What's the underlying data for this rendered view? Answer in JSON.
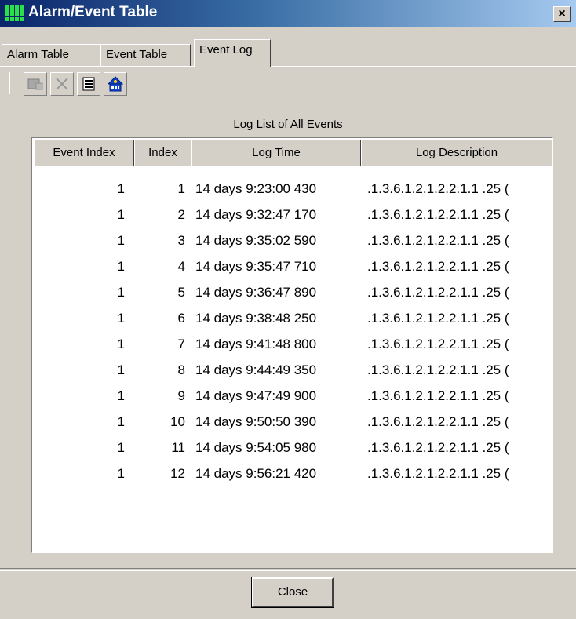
{
  "window": {
    "title": "Alarm/Event Table",
    "close_glyph": "×",
    "icon": "grid-app-icon"
  },
  "tabs": [
    {
      "label": "Alarm Table",
      "active": false
    },
    {
      "label": "Event Table",
      "active": false
    },
    {
      "label": "Event Log",
      "active": true
    }
  ],
  "toolbar": {
    "buttons": [
      {
        "icon": "edit-entry-icon",
        "enabled": false
      },
      {
        "icon": "delete-x-icon",
        "enabled": false
      },
      {
        "icon": "details-list-icon",
        "enabled": true
      },
      {
        "icon": "house-network-icon",
        "enabled": true
      }
    ]
  },
  "log_list": {
    "title": "Log List of All Events",
    "columns": [
      "Event Index",
      "Index",
      "Log Time",
      "Log Description"
    ],
    "rows": [
      {
        "event_index": "1",
        "index": "1",
        "log_time": "14 days 9:23:00 430",
        "log_description": ".1.3.6.1.2.1.2.2.1.1 .25 ("
      },
      {
        "event_index": "1",
        "index": "2",
        "log_time": "14 days 9:32:47 170",
        "log_description": ".1.3.6.1.2.1.2.2.1.1 .25 ("
      },
      {
        "event_index": "1",
        "index": "3",
        "log_time": "14 days 9:35:02 590",
        "log_description": ".1.3.6.1.2.1.2.2.1.1 .25 ("
      },
      {
        "event_index": "1",
        "index": "4",
        "log_time": "14 days 9:35:47 710",
        "log_description": ".1.3.6.1.2.1.2.2.1.1 .25 ("
      },
      {
        "event_index": "1",
        "index": "5",
        "log_time": "14 days 9:36:47 890",
        "log_description": ".1.3.6.1.2.1.2.2.1.1 .25 ("
      },
      {
        "event_index": "1",
        "index": "6",
        "log_time": "14 days 9:38:48 250",
        "log_description": ".1.3.6.1.2.1.2.2.1.1 .25 ("
      },
      {
        "event_index": "1",
        "index": "7",
        "log_time": "14 days 9:41:48 800",
        "log_description": ".1.3.6.1.2.1.2.2.1.1 .25 ("
      },
      {
        "event_index": "1",
        "index": "8",
        "log_time": "14 days 9:44:49 350",
        "log_description": ".1.3.6.1.2.1.2.2.1.1 .25 ("
      },
      {
        "event_index": "1",
        "index": "9",
        "log_time": "14 days 9:47:49 900",
        "log_description": ".1.3.6.1.2.1.2.2.1.1 .25 ("
      },
      {
        "event_index": "1",
        "index": "10",
        "log_time": "14 days 9:50:50 390",
        "log_description": ".1.3.6.1.2.1.2.2.1.1 .25 ("
      },
      {
        "event_index": "1",
        "index": "11",
        "log_time": "14 days 9:54:05 980",
        "log_description": ".1.3.6.1.2.1.2.2.1.1 .25 ("
      },
      {
        "event_index": "1",
        "index": "12",
        "log_time": "14 days 9:56:21 420",
        "log_description": ".1.3.6.1.2.1.2.2.1.1 .25 ("
      }
    ]
  },
  "footer": {
    "close_label": "Close"
  },
  "colors": {
    "title_start": "#0a246a",
    "title_end": "#a6caf0",
    "face": "#d4d0c8",
    "list_bg": "#ffffff"
  }
}
